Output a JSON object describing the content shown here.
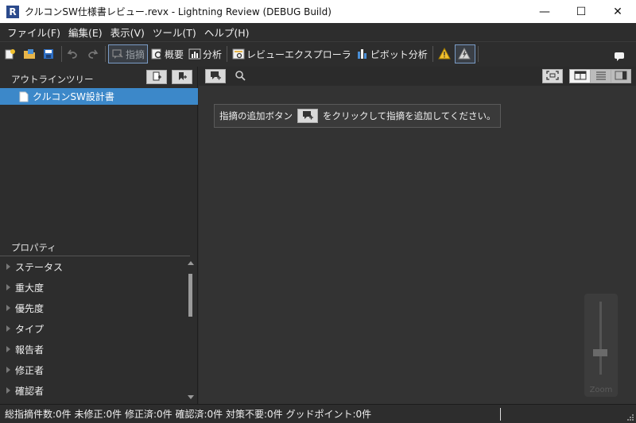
{
  "window": {
    "app_icon_letter": "R",
    "title": "クルコンSW仕様書レビュー.revx  - Lightning Review (DEBUG Build)",
    "minimize": "—",
    "maximize": "☐",
    "close": "✕"
  },
  "menu": [
    "ファイル(F)",
    "編集(E)",
    "表示(V)",
    "ツール(T)",
    "ヘルプ(H)"
  ],
  "toolbar": {
    "comment_label": "指摘",
    "summary_label": "概要",
    "analysis_label": "分析",
    "explorer_label": "レビューエクスプローラ",
    "pivot_label": "ピボット分析"
  },
  "outline": {
    "title": "アウトラインツリー",
    "selected_item": "クルコンSW設計書"
  },
  "properties": {
    "title": "プロパティ",
    "items": [
      "ステータス",
      "重大度",
      "優先度",
      "タイプ",
      "報告者",
      "修正者",
      "確認者"
    ]
  },
  "main": {
    "hint_before": "指摘の追加ボタン",
    "hint_after": "をクリックして指摘を追加してください。",
    "zoom_label": "Zoom"
  },
  "status": {
    "text": "総指摘件数:0件  未修正:0件  修正済:0件  確認済:0件  対策不要:0件  グッドポイント:0件"
  },
  "colors": {
    "selection": "#3c88c9",
    "background": "#2d2d2d",
    "content_background": "#333333"
  }
}
